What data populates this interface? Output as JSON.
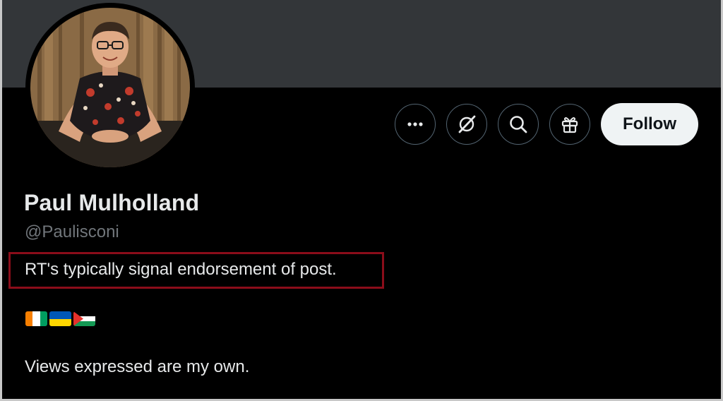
{
  "profile": {
    "display_name": "Paul Mulholland",
    "handle": "@Paulisconi",
    "bio_line1": "RT's typically signal endorsement of post.",
    "bio_line3": "Views expressed are my own.",
    "flags": [
      "cote-d-ivoire-flag",
      "ukraine-flag",
      "palestine-flag"
    ]
  },
  "actions": {
    "more_icon": "more-icon",
    "grok_icon": "grok-icon",
    "search_icon": "search-icon",
    "gift_icon": "gift-icon",
    "follow_label": "Follow"
  },
  "colors": {
    "banner": "#333639",
    "background": "#000000",
    "highlight_border": "#8b0d1a",
    "follow_bg": "#eff3f4",
    "secondary_text": "#71767b",
    "primary_text": "#e7e9ea"
  }
}
